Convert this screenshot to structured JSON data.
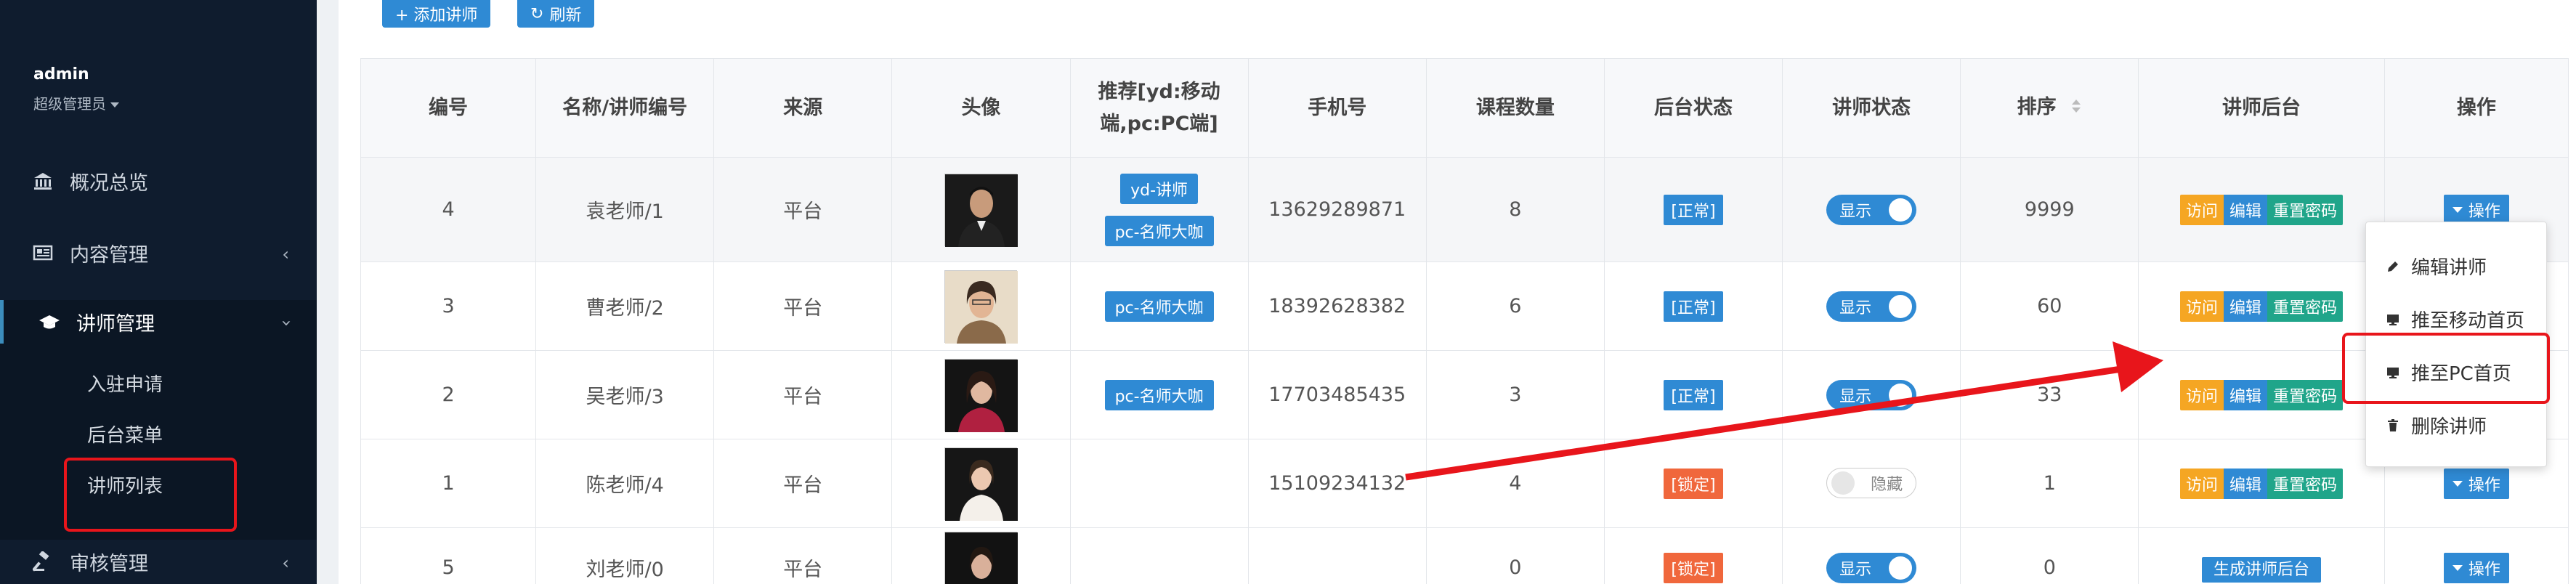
{
  "sidebar": {
    "user_name": "admin",
    "user_role": "超级管理员",
    "items": [
      {
        "label": "概况总览"
      },
      {
        "label": "内容管理"
      },
      {
        "label": "讲师管理"
      },
      {
        "label": "审核管理"
      }
    ],
    "subitems": [
      {
        "label": "入驻申请"
      },
      {
        "label": "后台菜单"
      },
      {
        "label": "讲师列表"
      }
    ]
  },
  "toolbar": {
    "add_label": "+ 添加讲师",
    "refresh_label": "刷新"
  },
  "table": {
    "headers": [
      "编号",
      "名称/讲师编号",
      "来源",
      "头像",
      "推荐[yd:移动端,pc:PC端]",
      "手机号",
      "课程数量",
      "后台状态",
      "讲师状态",
      "排序",
      "讲师后台",
      "操作"
    ],
    "rows": [
      {
        "id": "4",
        "name": "袁老师/1",
        "source": "平台",
        "tags": [
          "yd-讲师",
          "pc-名师大咖"
        ],
        "phone": "13629289871",
        "courses": "8",
        "admin_status": "[正常]",
        "status": "显示",
        "sort": "9999"
      },
      {
        "id": "3",
        "name": "曹老师/2",
        "source": "平台",
        "tags": [
          "pc-名师大咖"
        ],
        "phone": "18392628382",
        "courses": "6",
        "admin_status": "[正常]",
        "status": "显示",
        "sort": "60"
      },
      {
        "id": "2",
        "name": "吴老师/3",
        "source": "平台",
        "tags": [
          "pc-名师大咖"
        ],
        "phone": "17703485435",
        "courses": "3",
        "admin_status": "[正常]",
        "status": "显示",
        "sort": "33"
      },
      {
        "id": "1",
        "name": "陈老师/4",
        "source": "平台",
        "tags": [],
        "phone": "15109234132",
        "courses": "4",
        "admin_status": "[锁定]",
        "status": "隐藏",
        "sort": "1"
      },
      {
        "id": "5",
        "name": "刘老师/0",
        "source": "平台",
        "tags": [],
        "phone": "",
        "courses": "0",
        "admin_status": "[锁定]",
        "status": "显示",
        "sort": "0"
      }
    ],
    "backend_buttons": {
      "visit": "访问",
      "edit": "编辑",
      "reset": "重置密码",
      "generate": "生成讲师后台"
    },
    "op_label": "操作"
  },
  "dropdown": {
    "items": [
      {
        "label": "编辑讲师"
      },
      {
        "label": "推至移动首页"
      },
      {
        "label": "推至PC首页"
      },
      {
        "label": "删除讲师"
      }
    ]
  },
  "colors": {
    "sidebar_bg": "#0f1c2e",
    "primary": "#2f8ad4",
    "warning": "#f5a623",
    "success": "#20a58a",
    "danger": "#f0673c",
    "annotation": "#e8151b"
  }
}
